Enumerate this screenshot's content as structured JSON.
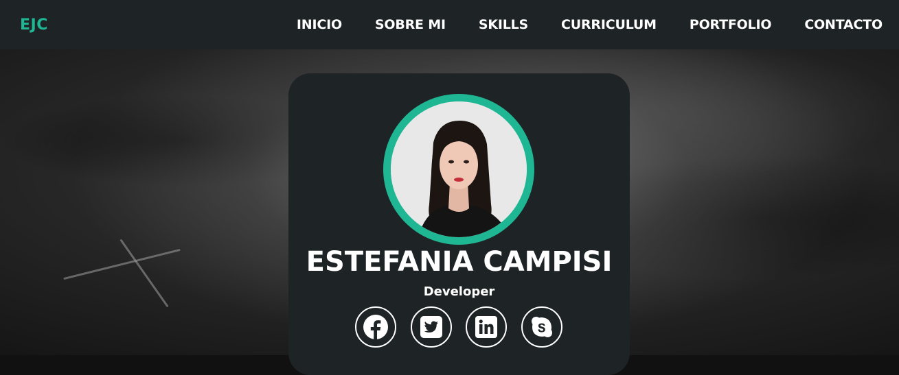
{
  "brand": {
    "logo_text": "EJC",
    "accent_color": "#1fb793"
  },
  "nav": {
    "items": [
      {
        "label": "INICIO"
      },
      {
        "label": "SOBRE MI"
      },
      {
        "label": "SKILLS"
      },
      {
        "label": "CURRICULUM"
      },
      {
        "label": "PORTFOLIO"
      },
      {
        "label": "CONTACTO"
      }
    ]
  },
  "profile": {
    "name": "ESTEFANIA CAMPISI",
    "role": "Developer",
    "ring_color": "#1fb793"
  },
  "socials": [
    {
      "icon": "facebook-icon"
    },
    {
      "icon": "twitter-icon"
    },
    {
      "icon": "linkedin-icon"
    },
    {
      "icon": "skype-icon"
    }
  ],
  "colors": {
    "navbar_bg": "#1e2326",
    "card_bg": "#1e2326",
    "text": "#ffffff"
  }
}
